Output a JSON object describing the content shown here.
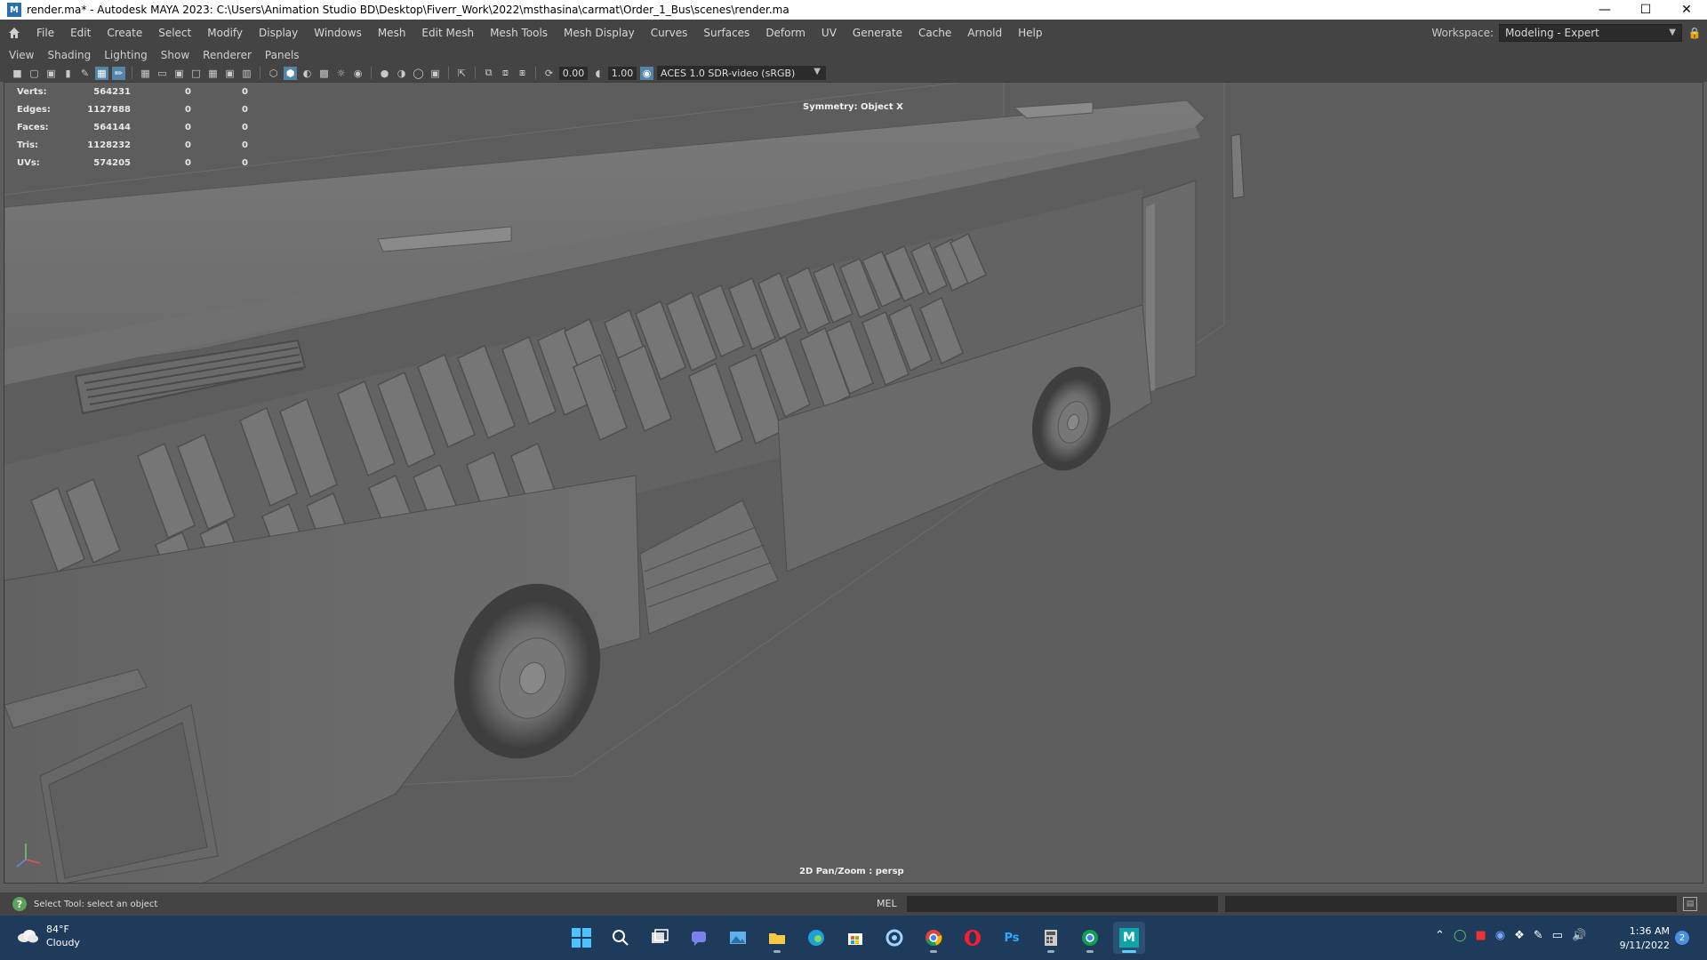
{
  "window": {
    "title": "render.ma* - Autodesk MAYA 2023: C:\\Users\\Animation Studio BD\\Desktop\\Fiverr_Work\\2022\\msthasina\\carmat\\Order_1_Bus\\scenes\\render.ma",
    "app_icon": "M"
  },
  "main_menu": [
    "File",
    "Edit",
    "Create",
    "Select",
    "Modify",
    "Display",
    "Windows",
    "Mesh",
    "Edit Mesh",
    "Mesh Tools",
    "Mesh Display",
    "Curves",
    "Surfaces",
    "Deform",
    "UV",
    "Generate",
    "Cache",
    "Arnold",
    "Help"
  ],
  "workspace": {
    "label": "Workspace:",
    "value": "Modeling - Expert"
  },
  "panel_menu": [
    "View",
    "Shading",
    "Lighting",
    "Show",
    "Renderer",
    "Panels"
  ],
  "panel_toolbar": {
    "exposure": "0.00",
    "gamma": "1.00",
    "color_space": "ACES 1.0 SDR-video (sRGB)"
  },
  "hud": {
    "rows": [
      {
        "label": "Verts:",
        "v1": "564231",
        "v2": "0",
        "v3": "0"
      },
      {
        "label": "Edges:",
        "v1": "1127888",
        "v2": "0",
        "v3": "0"
      },
      {
        "label": "Faces:",
        "v1": "564144",
        "v2": "0",
        "v3": "0"
      },
      {
        "label": "Tris:",
        "v1": "1128232",
        "v2": "0",
        "v3": "0"
      },
      {
        "label": "UVs:",
        "v1": "574205",
        "v2": "0",
        "v3": "0"
      }
    ],
    "symmetry": "Symmetry: Object X",
    "camera": "2D Pan/Zoom : persp"
  },
  "help_line": {
    "text": "Select Tool: select an object",
    "mel_label": "MEL"
  },
  "taskbar": {
    "weather_temp": "84°F",
    "weather_cond": "Cloudy",
    "time": "1:36 AM",
    "date": "9/11/2022",
    "notification_count": "2",
    "photoshop_label": "Ps",
    "maya_label": "M"
  },
  "colors": {
    "viewport_bg": "#5d5d5d",
    "ui_bg": "#444444",
    "taskbar_bg": "#1f3b5c",
    "accent": "#5285a6"
  }
}
